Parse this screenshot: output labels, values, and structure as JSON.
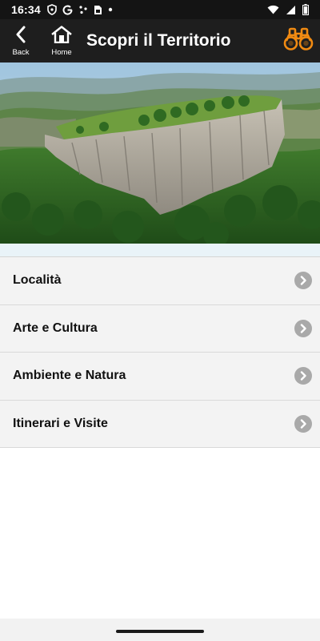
{
  "status_bar": {
    "time": "16:34",
    "left_icons": [
      "shield-icon",
      "google-icon",
      "dots-icon",
      "sim-card-icon",
      "dot-icon"
    ],
    "right_icons": [
      "wifi-icon",
      "signal-icon",
      "battery-icon"
    ]
  },
  "app_bar": {
    "back_label": "Back",
    "home_label": "Home",
    "title": "Scopri il Territorio",
    "accent_color": "#f08a12"
  },
  "hero": {
    "icon": "landscape-image"
  },
  "menu": {
    "items": [
      {
        "label": "Località",
        "icon": "chevron-right-icon"
      },
      {
        "label": "Arte e Cultura",
        "icon": "chevron-right-icon"
      },
      {
        "label": "Ambiente e Natura",
        "icon": "chevron-right-icon"
      },
      {
        "label": "Itinerari e Visite",
        "icon": "chevron-right-icon"
      }
    ]
  }
}
